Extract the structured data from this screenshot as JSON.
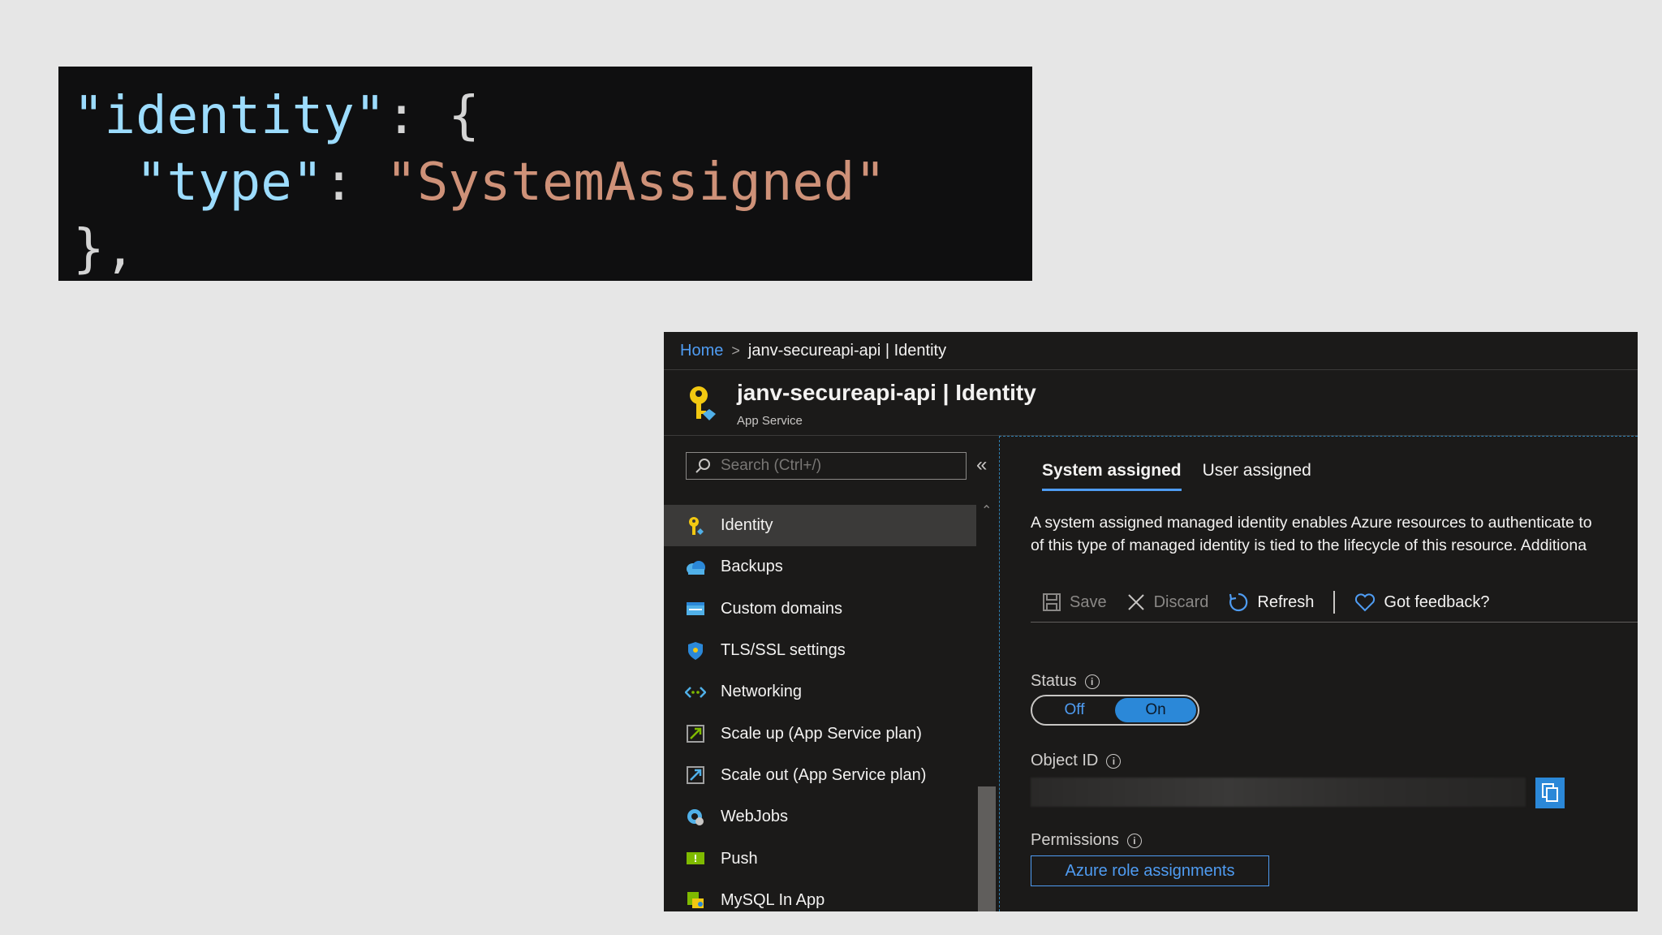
{
  "code": {
    "line1_key": "\"identity\"",
    "line1_rest": ": {",
    "line2_key": "\"type\"",
    "line2_colon": ": ",
    "line2_value": "\"SystemAssigned\"",
    "line3": "},"
  },
  "breadcrumb": {
    "home": "Home",
    "current": "janv-secureapi-api | Identity"
  },
  "header": {
    "title": "janv-secureapi-api | Identity",
    "subtitle": "App Service"
  },
  "search": {
    "placeholder": "Search (Ctrl+/)"
  },
  "menu": {
    "collapse_glyph": "«",
    "items": [
      {
        "label": "Identity",
        "icon": "key-icon",
        "active": true
      },
      {
        "label": "Backups",
        "icon": "cloud-icon"
      },
      {
        "label": "Custom domains",
        "icon": "window-icon"
      },
      {
        "label": "TLS/SSL settings",
        "icon": "shield-icon"
      },
      {
        "label": "Networking",
        "icon": "network-icon"
      },
      {
        "label": "Scale up (App Service plan)",
        "icon": "scale-icon"
      },
      {
        "label": "Scale out (App Service plan)",
        "icon": "scale-icon"
      },
      {
        "label": "WebJobs",
        "icon": "gear-globe-icon"
      },
      {
        "label": "Push",
        "icon": "push-icon"
      },
      {
        "label": "MySQL In App",
        "icon": "database-icon"
      }
    ]
  },
  "tabs": [
    {
      "label": "System assigned",
      "active": true
    },
    {
      "label": "User assigned"
    }
  ],
  "description": {
    "line1": "A system assigned managed identity enables Azure resources to authenticate to",
    "line2": "of this type of managed identity is tied to the lifecycle of this resource. Additiona"
  },
  "toolbar": {
    "save": "Save",
    "discard": "Discard",
    "refresh": "Refresh",
    "feedback": "Got feedback?"
  },
  "status": {
    "label": "Status",
    "off": "Off",
    "on": "On",
    "value": "On"
  },
  "object_id": {
    "label": "Object ID"
  },
  "permissions": {
    "label": "Permissions",
    "button": "Azure role assignments"
  },
  "colors": {
    "accent": "#2b88d8",
    "link": "#4f9cf2",
    "background": "#1b1a19"
  }
}
